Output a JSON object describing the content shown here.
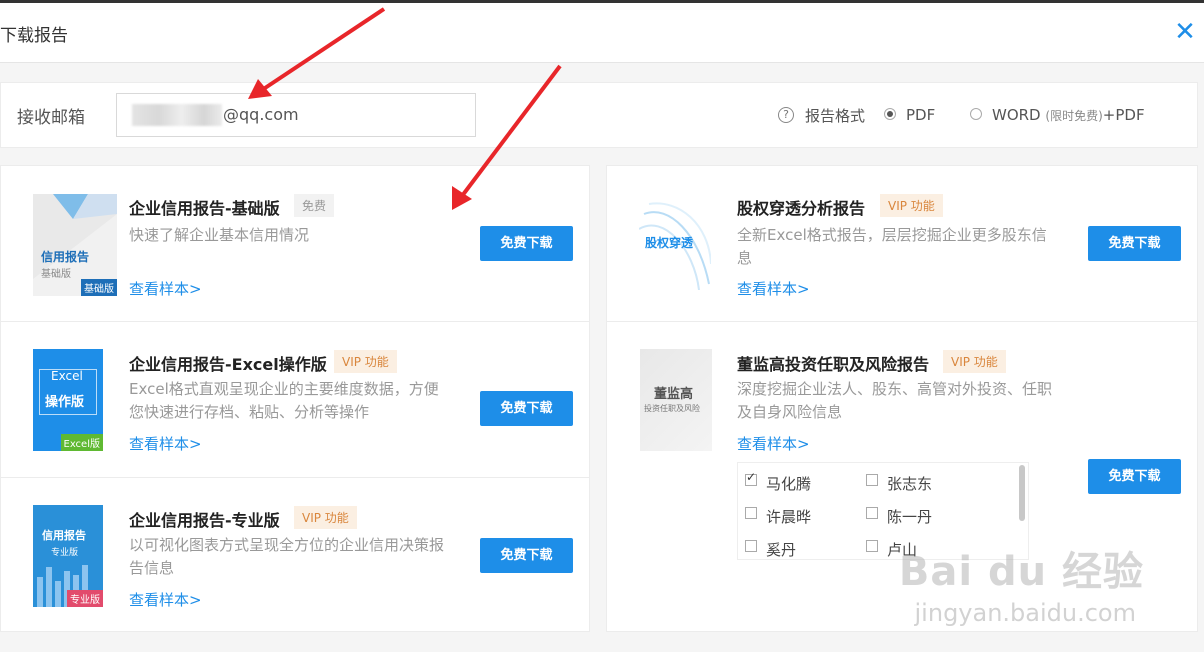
{
  "header": {
    "title": "下载报告",
    "close_icon": "close-icon"
  },
  "email": {
    "label": "接收邮箱",
    "value": "@qq.com",
    "format_label": "报告格式",
    "pdf_label": "PDF",
    "word_label": "WORD",
    "word_note": "(限时免费)",
    "word_suffix": "+PDF",
    "selected_format": "PDF"
  },
  "left_cards": [
    {
      "title": "企业信用报告-基础版",
      "badge": "免费",
      "desc": "快速了解企业基本信用情况",
      "link": "查看样本>",
      "button": "免费下载",
      "thumb_title": "信用报告",
      "thumb_sub": "基础版",
      "thumb_tag": "基础版"
    },
    {
      "title": "企业信用报告-Excel操作版",
      "badge": "VIP 功能",
      "desc": "Excel格式直观呈现企业的主要维度数据，方便 您快速进行存档、粘贴、分析等操作",
      "link": "查看样本>",
      "button": "免费下载",
      "thumb_title": "Excel",
      "thumb_sub": "操作版",
      "thumb_tag": "Excel版"
    },
    {
      "title": "企业信用报告-专业版",
      "badge": "VIP 功能",
      "desc": "以可视化图表方式呈现全方位的企业信用决策报告信息",
      "link": "查看样本>",
      "button": "免费下载",
      "thumb_title": "信用报告",
      "thumb_sub": "专业版",
      "thumb_tag": "专业版"
    }
  ],
  "right_cards": [
    {
      "title": "股权穿透分析报告",
      "badge": "VIP 功能",
      "desc": "全新Excel格式报告，层层挖掘企业更多股东信息",
      "link": "查看样本>",
      "button": "免费下载",
      "thumb_title": "股权穿透"
    },
    {
      "title": "董监高投资任职及风险报告",
      "badge": "VIP 功能",
      "desc": "深度挖掘企业法人、股东、高管对外投资、任职及自身风险信息",
      "link": "查看样本>",
      "button": "免费下载",
      "thumb_title": "董监高",
      "thumb_sub": "投资任职及风险"
    }
  ],
  "people": [
    {
      "name": "马化腾",
      "checked": true
    },
    {
      "name": "张志东",
      "checked": false
    },
    {
      "name": "许晨晔",
      "checked": false
    },
    {
      "name": "陈一丹",
      "checked": false
    },
    {
      "name": "奚丹",
      "checked": false
    },
    {
      "name": "卢山",
      "checked": false
    }
  ],
  "watermark": {
    "main": "Bai du 经验",
    "sub": "jingyan.baidu.com"
  },
  "colors": {
    "accent": "#1e8ee8",
    "vip": "#d9863c",
    "arrow": "#e8262a"
  }
}
